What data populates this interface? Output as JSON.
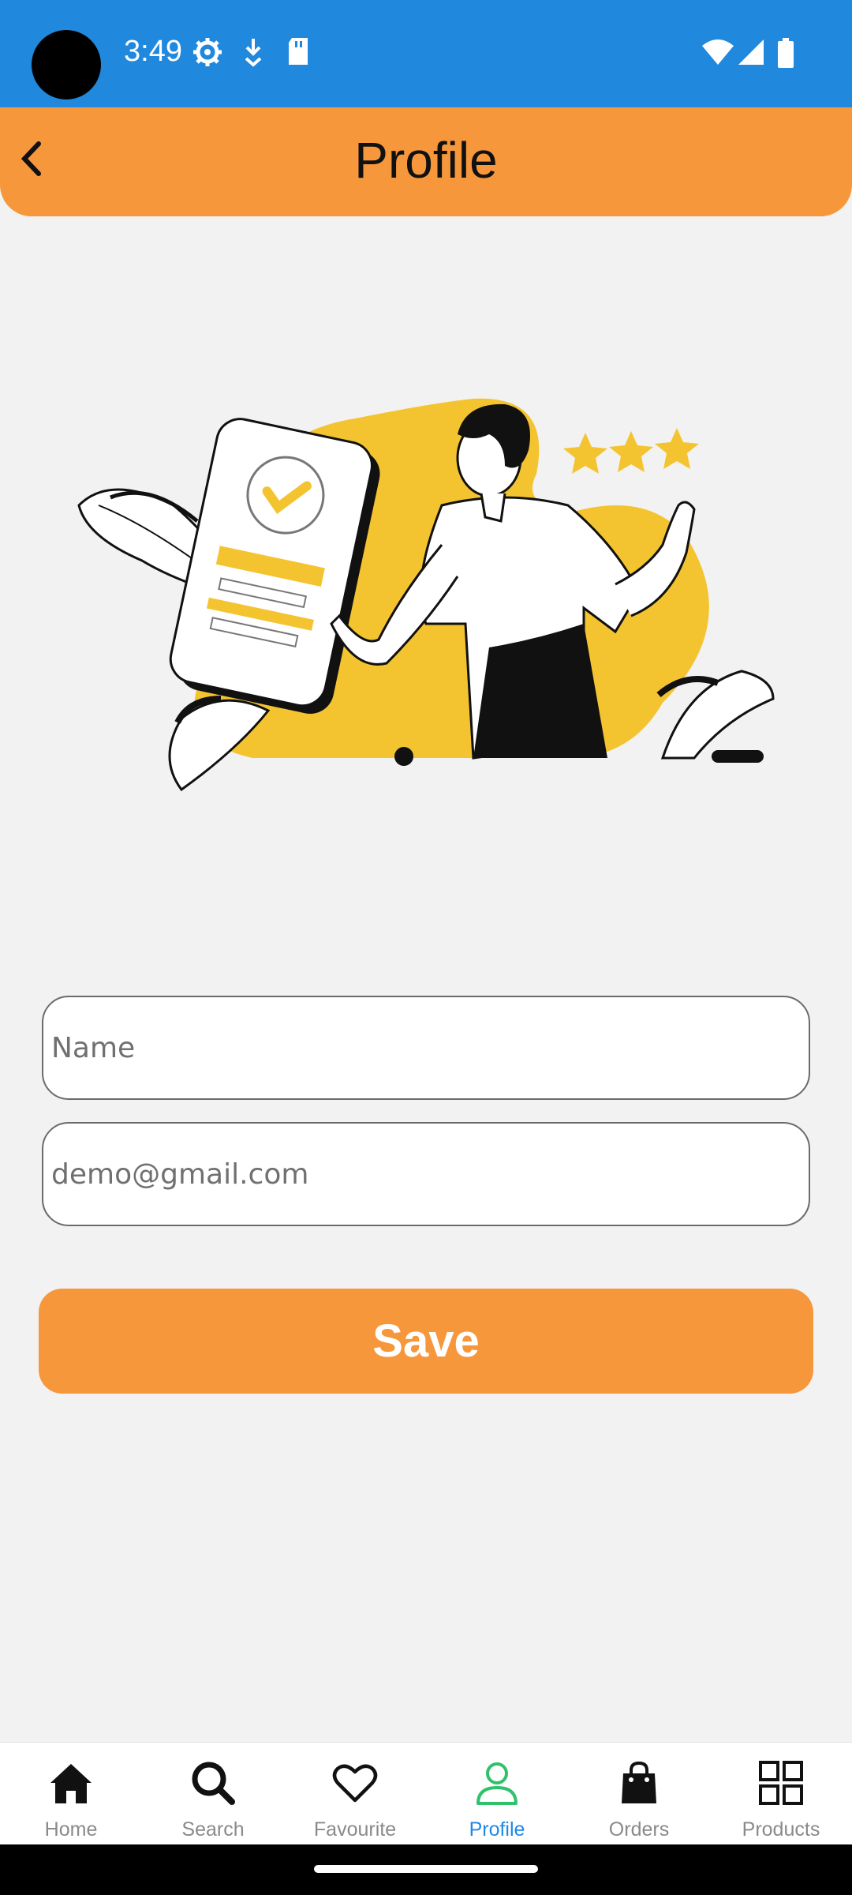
{
  "status_bar": {
    "time": "3:49",
    "left_icons": [
      "settings-gear-icon",
      "download-arrow-icon",
      "sd-card-icon"
    ],
    "right_icons": [
      "wifi-icon",
      "signal-icon",
      "battery-icon"
    ],
    "background": "#2088dd"
  },
  "app_bar": {
    "title": "Profile",
    "background": "#f7973c"
  },
  "form": {
    "name_placeholder": "Name",
    "name_value": "",
    "email_placeholder": "demo@gmail.com",
    "email_value": ""
  },
  "save_button": {
    "label": "Save",
    "color": "#f7973c"
  },
  "bottom_nav": {
    "active_color": "#1e88e5",
    "items": [
      {
        "label": "Home",
        "icon": "home-icon"
      },
      {
        "label": "Search",
        "icon": "search-icon"
      },
      {
        "label": "Favourite",
        "icon": "heart-icon"
      },
      {
        "label": "Profile",
        "icon": "user-icon",
        "active": true
      },
      {
        "label": "Orders",
        "icon": "shopping-bag-icon"
      },
      {
        "label": "Products",
        "icon": "grid-icon"
      }
    ]
  }
}
